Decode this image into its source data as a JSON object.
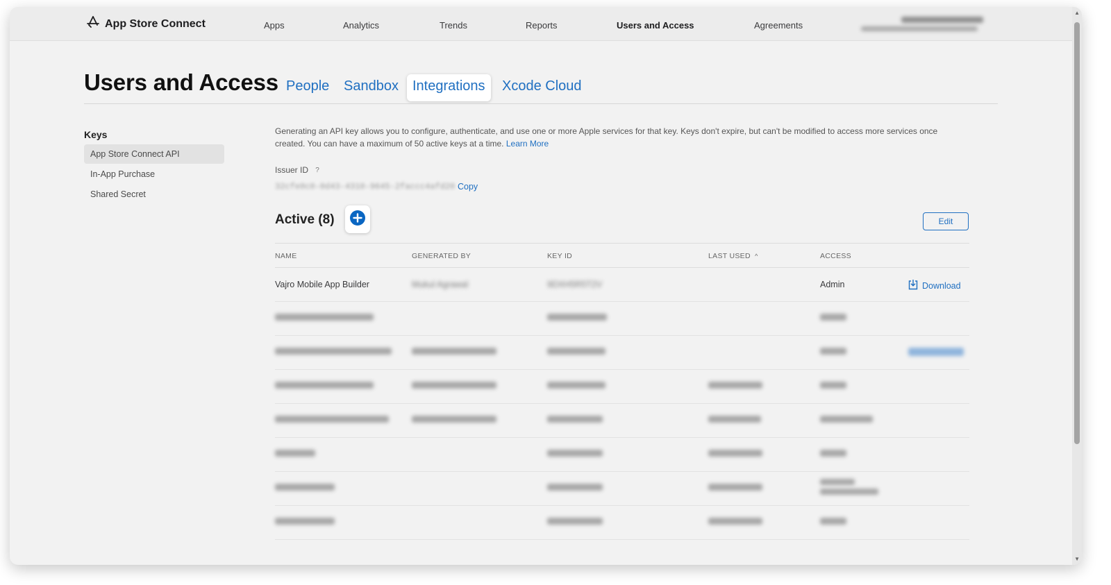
{
  "header": {
    "brand": "App Store Connect",
    "nav": [
      "Apps",
      "Analytics",
      "Trends",
      "Reports",
      "Users and Access",
      "Agreements"
    ],
    "active_nav": "Users and Access"
  },
  "page": {
    "title": "Users and Access",
    "tabs": [
      "People",
      "Sandbox",
      "Integrations",
      "Xcode Cloud"
    ],
    "selected_tab": "Integrations"
  },
  "sidebar": {
    "heading": "Keys",
    "items": [
      "App Store Connect API",
      "In-App Purchase",
      "Shared Secret"
    ],
    "selected": "App Store Connect API"
  },
  "content": {
    "description": "Generating an API key allows you to configure, authenticate, and use one or more Apple services for that key. Keys don't expire, but can't be modified to access more services once created. You can have a maximum of 50 active keys at a time.",
    "learn_more": "Learn More",
    "issuer_label": "Issuer ID",
    "issuer_help": "?",
    "issuer_value": "32cfe0c0-0d43-4310-9645-2faccc4afd20",
    "copy_label": "Copy",
    "active_title": "Active (8)",
    "edit_label": "Edit"
  },
  "table": {
    "headers": {
      "name": "NAME",
      "generated_by": "GENERATED BY",
      "key_id": "KEY ID",
      "last_used": "LAST USED",
      "access": "ACCESS"
    },
    "sort_indicator": "^",
    "rows": [
      {
        "name": "Vajro Mobile App Builder",
        "generated_by": "Mukul Agrawal",
        "key_id": "9DXH5R5T2V",
        "last_used": "",
        "access": "Admin",
        "download": "Download"
      }
    ]
  },
  "colors": {
    "accent": "#1f6fc1",
    "add_button": "#0a66c2"
  }
}
